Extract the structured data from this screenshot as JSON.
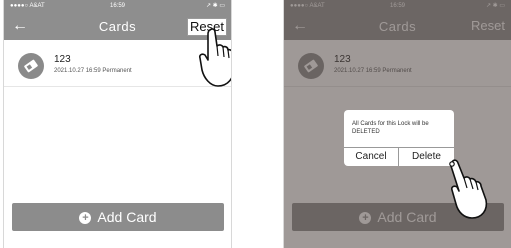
{
  "status": {
    "carrier": "●●●●○ A&AT",
    "time": "16:59",
    "right": "↗ ✱ ▭"
  },
  "nav": {
    "back": "←",
    "title": "Cards",
    "reset": "Reset"
  },
  "card": {
    "name": "123",
    "meta": "2021.10.27 16:59  Permanent",
    "icon": "card-key-icon"
  },
  "add_button": {
    "label": "Add Card",
    "icon": "plus-circle-icon"
  },
  "dialog": {
    "message": "All Cards for this Lock will be DELETED",
    "cancel": "Cancel",
    "delete": "Delete"
  },
  "colors": {
    "bar": "#8e8e8e",
    "button": "#8c8c8c",
    "overlay": "#50463f"
  }
}
